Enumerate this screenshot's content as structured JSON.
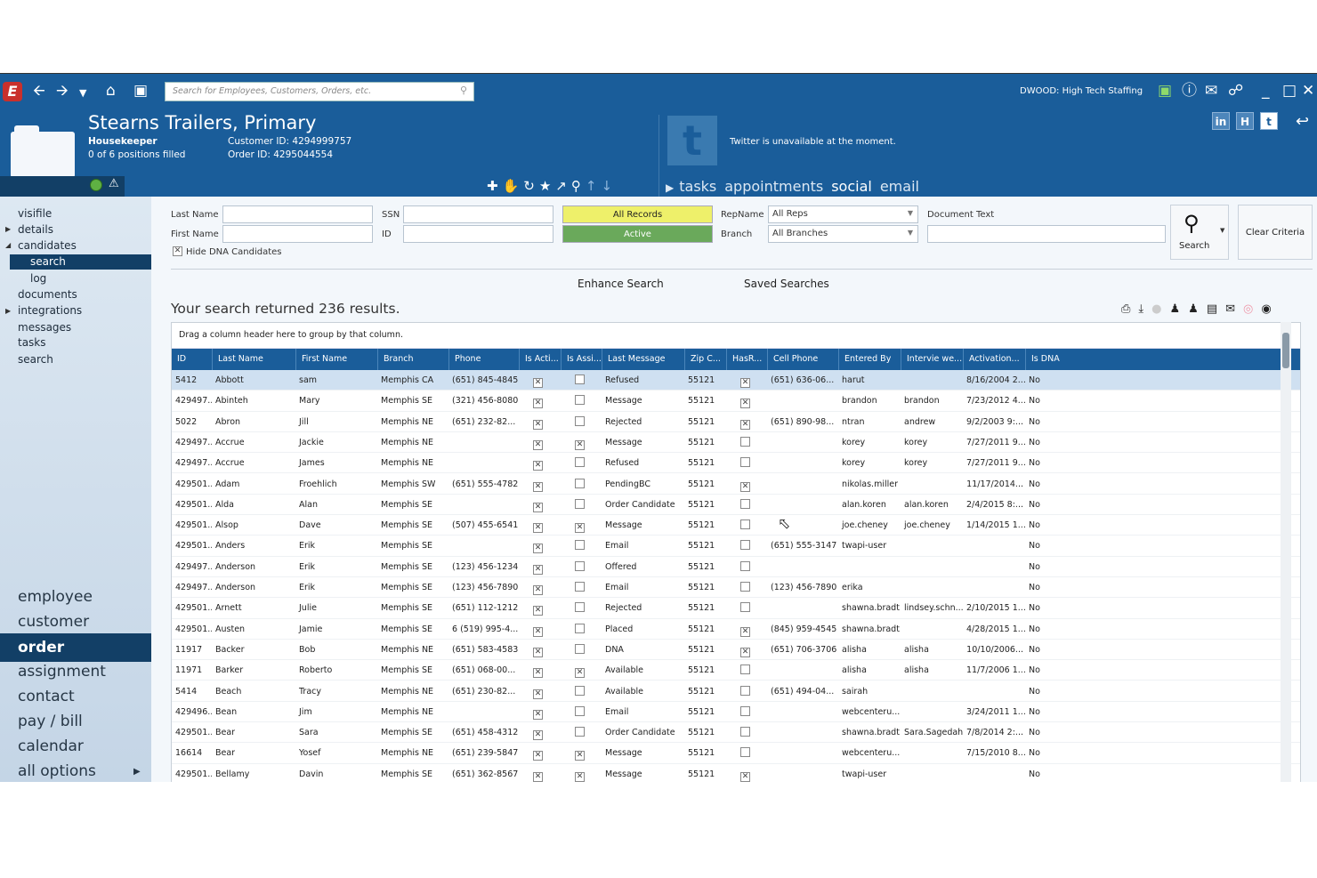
{
  "topbar": {
    "search_placeholder": "Search for Employees, Customers, Orders, etc.",
    "user_label": "DWOOD: High Tech Staffing"
  },
  "header": {
    "title": "Stearns Trailers, Primary",
    "role": "Housekeeper",
    "positions": "0 of 6 positions filled",
    "customer_id": "Customer ID: 4294999757",
    "order_id": "Order ID: 4295044554",
    "twitter_msg": "Twitter is unavailable at the moment.",
    "social_buttons": [
      "in",
      "H",
      "t"
    ],
    "tabs": [
      "tasks",
      "appointments",
      "social",
      "email"
    ]
  },
  "sidebar": {
    "items": [
      "visifile",
      "details",
      "candidates",
      "search",
      "log",
      "documents",
      "integrations",
      "messages",
      "tasks",
      "search"
    ],
    "main_nav": [
      "employee",
      "customer",
      "order",
      "assignment",
      "contact",
      "pay / bill",
      "calendar",
      "all options"
    ]
  },
  "form": {
    "last_name": "Last Name",
    "first_name": "First Name",
    "ssn": "SSN",
    "id": "ID",
    "all_records": "All Records",
    "active": "Active",
    "rep_name": "RepName",
    "rep_value": "All Reps",
    "branch": "Branch",
    "branch_value": "All Branches",
    "doc_text": "Document Text",
    "hide_dna": "Hide DNA Candidates",
    "search": "Search",
    "clear": "Clear Criteria",
    "enhance": "Enhance Search",
    "saved": "Saved Searches"
  },
  "results_text": "Your search returned 236 results.",
  "grid": {
    "group_hint": "Drag a column header here to group by that column.",
    "columns": [
      "ID",
      "Last Name",
      "First Name",
      "Branch",
      "Phone",
      "Is Acti...",
      "Is Assi...",
      "Last Message",
      "Zip C...",
      "HasR...",
      "Cell Phone",
      "Entered By",
      "Intervie we...",
      "Activation...",
      "Is DNA"
    ],
    "rows": [
      [
        "5412",
        "Abbott",
        "sam",
        "Memphis CA",
        "(651) 845-4845",
        1,
        0,
        "Refused",
        "55121",
        1,
        "(651) 636-06...",
        "harut",
        "",
        "8/16/2004 2...",
        "No"
      ],
      [
        "429497...",
        "Abinteh",
        "Mary",
        "Memphis SE",
        "(321) 456-8080",
        1,
        0,
        "Message",
        "55121",
        1,
        "",
        "brandon",
        "brandon",
        "7/23/2012 4...",
        "No"
      ],
      [
        "5022",
        "Abron",
        "Jill",
        "Memphis NE",
        "(651) 232-82...",
        1,
        0,
        "Rejected",
        "55121",
        1,
        "(651) 890-98...",
        "ntran",
        "andrew",
        "9/2/2003 9:...",
        "No"
      ],
      [
        "429497...",
        "Accrue",
        "Jackie",
        "Memphis NE",
        "",
        1,
        1,
        "Message",
        "55121",
        0,
        "",
        "korey",
        "korey",
        "7/27/2011 9...",
        "No"
      ],
      [
        "429497...",
        "Accrue",
        "James",
        "Memphis NE",
        "",
        1,
        0,
        "Refused",
        "55121",
        0,
        "",
        "korey",
        "korey",
        "7/27/2011 9...",
        "No"
      ],
      [
        "429501...",
        "Adam",
        "Froehlich",
        "Memphis SW",
        "(651) 555-4782",
        1,
        0,
        "PendingBC",
        "55121",
        1,
        "",
        "nikolas.miller",
        "",
        "11/17/2014...",
        "No"
      ],
      [
        "429501...",
        "Alda",
        "Alan",
        "Memphis SE",
        "",
        1,
        0,
        "Order Candidate",
        "55121",
        0,
        "",
        "alan.koren",
        "alan.koren",
        "2/4/2015 8:...",
        "No"
      ],
      [
        "429501...",
        "Alsop",
        "Dave",
        "Memphis SE",
        "(507) 455-6541",
        1,
        1,
        "Message",
        "55121",
        0,
        "",
        "joe.cheney",
        "joe.cheney",
        "1/14/2015 1...",
        "No"
      ],
      [
        "429501...",
        "Anders",
        "Erik",
        "Memphis SE",
        "",
        1,
        0,
        "Email",
        "55121",
        0,
        "(651) 555-3147",
        "twapi-user",
        "",
        "",
        "No"
      ],
      [
        "429497...",
        "Anderson",
        "Erik",
        "Memphis SE",
        "(123) 456-1234",
        1,
        0,
        "Offered",
        "55121",
        0,
        "",
        "",
        "",
        "",
        "No"
      ],
      [
        "429497...",
        "Anderson",
        "Erik",
        "Memphis SE",
        "(123) 456-7890",
        1,
        0,
        "Email",
        "55121",
        0,
        "(123) 456-7890",
        "erika",
        "",
        "",
        "No"
      ],
      [
        "429501...",
        "Arnett",
        "Julie",
        "Memphis SE",
        "(651) 112-1212",
        1,
        0,
        "Rejected",
        "55121",
        0,
        "",
        "shawna.bradt",
        "lindsey.schn...",
        "2/10/2015 1...",
        "No"
      ],
      [
        "429501...",
        "Austen",
        "Jamie",
        "Memphis SE",
        "6 (519) 995-4...",
        1,
        0,
        "Placed",
        "55121",
        1,
        "(845) 959-4545",
        "shawna.bradt",
        "",
        "4/28/2015 1...",
        "No"
      ],
      [
        "11917",
        "Backer",
        "Bob",
        "Memphis NE",
        "(651) 583-4583",
        1,
        0,
        "DNA",
        "55121",
        1,
        "(651) 706-3706",
        "alisha",
        "alisha",
        "10/10/2006...",
        "No"
      ],
      [
        "11971",
        "Barker",
        "Roberto",
        "Memphis SE",
        "(651) 068-00...",
        1,
        1,
        "Available",
        "55121",
        0,
        "",
        "alisha",
        "alisha",
        "11/7/2006 1...",
        "No"
      ],
      [
        "5414",
        "Beach",
        "Tracy",
        "Memphis NE",
        "(651) 230-82...",
        1,
        0,
        "Available",
        "55121",
        0,
        "(651) 494-04...",
        "sairah",
        "",
        "",
        "No"
      ],
      [
        "429496...",
        "Bean",
        "Jim",
        "Memphis NE",
        "",
        1,
        0,
        "Email",
        "55121",
        0,
        "",
        "webcenteru...",
        "",
        "3/24/2011 1...",
        "No"
      ],
      [
        "429501...",
        "Bear",
        "Sara",
        "Memphis SE",
        "(651) 458-4312",
        1,
        0,
        "Order Candidate",
        "55121",
        0,
        "",
        "shawna.bradt",
        "Sara.Sagedahl",
        "7/8/2014 2:...",
        "No"
      ],
      [
        "16614",
        "Bear",
        "Yosef",
        "Memphis NE",
        "(651) 239-5847",
        1,
        1,
        "Message",
        "55121",
        0,
        "",
        "webcenteru...",
        "",
        "7/15/2010 8...",
        "No"
      ],
      [
        "429501...",
        "Bellamy",
        "Davin",
        "Memphis SE",
        "(651) 362-8567",
        1,
        1,
        "Message",
        "55121",
        1,
        "",
        "twapi-user",
        "",
        "",
        "No"
      ]
    ]
  },
  "icons": [
    "back-arrow-icon",
    "forward-arrow-icon",
    "home-icon",
    "save-icon",
    "help-icon",
    "globe-icon",
    "print-icon",
    "mail-icon"
  ]
}
